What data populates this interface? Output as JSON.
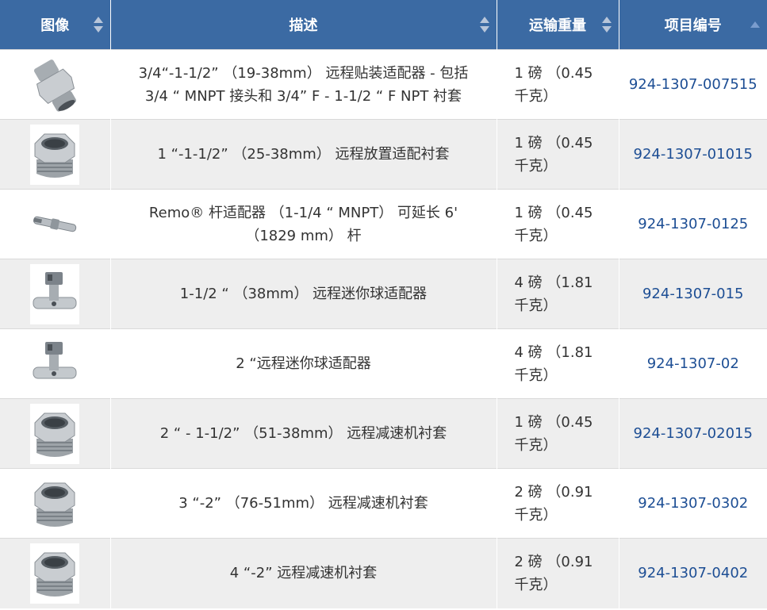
{
  "table": {
    "headers": {
      "image": "图像",
      "description": "描述",
      "weight": "运输重量",
      "item_number": "项目编号"
    },
    "rows": [
      {
        "icon": "hex-nipple-icon",
        "description": "3/4“-1-1/2” （19-38mm） 远程贴装适配器 - 包括 3/4 “ MNPT 接头和 3/4” F - 1-1/2 “ F NPT 衬套",
        "weight": "1 磅 （0.45 千克）",
        "item_number": "924-1307-007515"
      },
      {
        "icon": "hex-bushing-icon",
        "description": "1 “-1-1/2” （25-38mm） 远程放置适配衬套",
        "weight": "1 磅 （0.45 千克）",
        "item_number": "924-1307-01015"
      },
      {
        "icon": "rod-adapter-icon",
        "description": "Remo® 杆适配器 （1-1/4 “ MNPT） 可延长 6' （1829 mm） 杆",
        "weight": "1 磅 （0.45 千克）",
        "item_number": "924-1307-0125"
      },
      {
        "icon": "mini-ball-adapter-icon",
        "description": "1-1/2 “ （38mm） 远程迷你球适配器",
        "weight": "4 磅 （1.81 千克）",
        "item_number": "924-1307-015"
      },
      {
        "icon": "mini-ball-adapter-icon",
        "description": "2 “远程迷你球适配器",
        "weight": "4 磅 （1.81 千克）",
        "item_number": "924-1307-02"
      },
      {
        "icon": "hex-bushing-icon",
        "description": "2 “ - 1-1/2” （51-38mm） 远程减速机衬套",
        "weight": "1 磅 （0.45 千克）",
        "item_number": "924-1307-02015"
      },
      {
        "icon": "hex-bushing-icon",
        "description": "3 “-2” （76-51mm） 远程减速机衬套",
        "weight": "2 磅 （0.91 千克）",
        "item_number": "924-1307-0302"
      },
      {
        "icon": "hex-bushing-icon",
        "description": "4 “-2” 远程减速机衬套",
        "weight": "2 磅 （0.91 千克）",
        "item_number": "924-1307-0402"
      }
    ]
  },
  "colors": {
    "header_bg": "#3b6aa3",
    "header_text": "#ffffff",
    "row_alt_bg": "#eeeeee",
    "link": "#1d4e94"
  }
}
